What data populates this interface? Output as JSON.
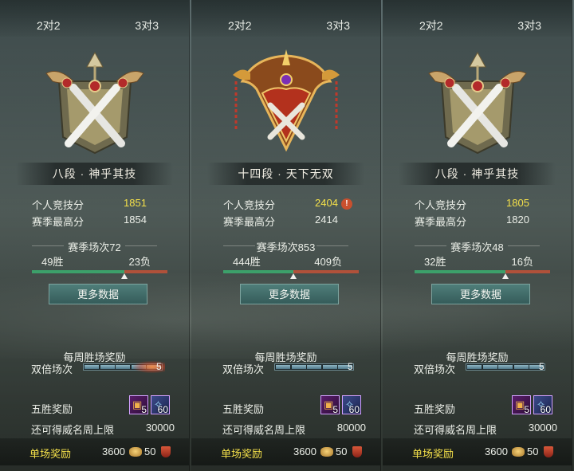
{
  "panels": [
    {
      "tabs": [
        "2对2",
        "3对3"
      ],
      "rank": "八段 · 神乎其技",
      "emblem_icon": "crossed-swords-rank-emblem",
      "personal_score_label": "个人竞技分",
      "personal_score": "1851",
      "season_high_label": "赛季最高分",
      "season_high": "1854",
      "warning": "",
      "season_matches": "赛季场次72",
      "wins": "49胜",
      "losses": "23负",
      "win_ratio": 0.68,
      "more_button": "更多数据",
      "weekly_title": "每周胜场奖励",
      "double_label": "双倍场次",
      "double_count": "5",
      "double_progress": 0.8,
      "five_win_label": "五胜奖励",
      "reward_chest_count": "5",
      "reward_potion_count": "60",
      "cap_label": "还可得威名周上限",
      "cap_value": "30000",
      "single_label": "单场奖励",
      "single_coin": "3600",
      "single_prestige": "50"
    },
    {
      "tabs": [
        "2对2",
        "3对3"
      ],
      "rank": "十四段 · 天下无双",
      "emblem_icon": "golden-winged-rank-emblem",
      "personal_score_label": "个人竞技分",
      "personal_score": "2404",
      "season_high_label": "赛季最高分",
      "season_high": "2414",
      "warning": "!",
      "season_matches": "赛季场次853",
      "wins": "444胜",
      "losses": "409负",
      "win_ratio": 0.52,
      "more_button": "更多数据",
      "weekly_title": "每周胜场奖励",
      "double_label": "双倍场次",
      "double_count": "5",
      "double_progress": 0.9,
      "five_win_label": "五胜奖励",
      "reward_chest_count": "5",
      "reward_potion_count": "60",
      "cap_label": "还可得威名周上限",
      "cap_value": "80000",
      "single_label": "单场奖励",
      "single_coin": "3600",
      "single_prestige": "50"
    },
    {
      "tabs": [
        "2对2",
        "3对3"
      ],
      "rank": "八段 · 神乎其技",
      "emblem_icon": "crossed-swords-rank-emblem",
      "personal_score_label": "个人竞技分",
      "personal_score": "1805",
      "season_high_label": "赛季最高分",
      "season_high": "1820",
      "warning": "",
      "season_matches": "赛季场次48",
      "wins": "32胜",
      "losses": "16负",
      "win_ratio": 0.67,
      "more_button": "更多数据",
      "weekly_title": "每周胜场奖励",
      "double_label": "双倍场次",
      "double_count": "5",
      "double_progress": 0.9,
      "five_win_label": "五胜奖励",
      "reward_chest_count": "5",
      "reward_potion_count": "60",
      "cap_label": "还可得威名周上限",
      "cap_value": "30000",
      "single_label": "单场奖励",
      "single_coin": "3600",
      "single_prestige": "50"
    }
  ],
  "colors": {
    "score_gold": "#f4e04a",
    "win_bar": "#3ca06a",
    "loss_bar": "#b0513a",
    "button": "#3f6a67"
  }
}
